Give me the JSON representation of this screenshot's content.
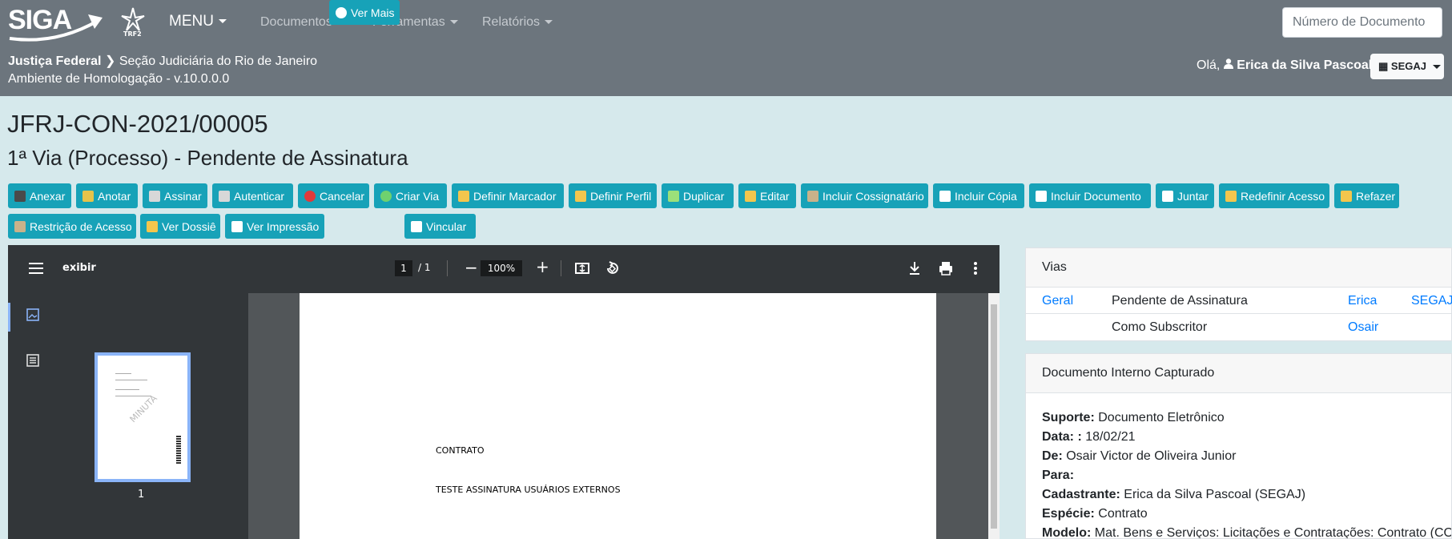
{
  "header": {
    "logo_text": "SIGA",
    "trf_label": "TRF2",
    "menu_label": "MENU",
    "nav": [
      "Documentos",
      "Ferramentas",
      "Relatórios"
    ],
    "search_placeholder": "Número de Documento",
    "breadcrumb_root": "Justiça Federal",
    "breadcrumb_child": "Seção Judiciária do Rio de Janeiro",
    "environment": "Ambiente de Homologação - v.10.0.0.0",
    "greeting": "Olá,",
    "user_name": "Erica da Silva Pascoal",
    "lotacao": "SEGAJ"
  },
  "document": {
    "code": "JFRJ-CON-2021/00005",
    "status": "1ª Via (Processo) - Pendente de Assinatura"
  },
  "actions": [
    {
      "label": "Anexar",
      "icon": "pen-icon",
      "color": "#4a4a4a"
    },
    {
      "label": "Anotar",
      "icon": "note-icon",
      "color": "#e6c34a"
    },
    {
      "label": "Assinar",
      "icon": "sign-icon",
      "color": "#d8d8d8"
    },
    {
      "label": "Autenticar",
      "icon": "authenticate-icon",
      "color": "#d8d8d8"
    },
    {
      "label": "Cancelar",
      "icon": "cancel-icon",
      "color": "#e03a3a"
    },
    {
      "label": "Criar Via",
      "icon": "add-icon",
      "color": "#6fd16f"
    },
    {
      "label": "Definir Marcador",
      "icon": "folder-icon",
      "color": "#f3c64d"
    },
    {
      "label": "Definir Perfil",
      "icon": "folder-user-icon",
      "color": "#f3c64d"
    },
    {
      "label": "Duplicar",
      "icon": "fork-icon",
      "color": "#9be07a"
    },
    {
      "label": "Editar",
      "icon": "pencil-icon",
      "color": "#f3c64d"
    },
    {
      "label": "Incluir Cossignatário",
      "icon": "user-add-icon",
      "color": "#c9b28a"
    },
    {
      "label": "Incluir Cópia",
      "icon": "copy-icon",
      "color": "#ffffff"
    },
    {
      "label": "Incluir Documento",
      "icon": "document-add-icon",
      "color": "#ffffff"
    },
    {
      "label": "Juntar",
      "icon": "attach-icon",
      "color": "#ffffff"
    },
    {
      "label": "Redefinir Acesso",
      "icon": "shield-icon",
      "color": "#f3c64d"
    },
    {
      "label": "Refazer",
      "icon": "warning-icon",
      "color": "#f3c64d"
    },
    {
      "label": "Restrição de Acesso",
      "icon": "user-lock-icon",
      "color": "#c9b28a"
    },
    {
      "label": "Ver Dossiê",
      "icon": "folder-open-icon",
      "color": "#f3c64d"
    },
    {
      "label": "Ver Impressão",
      "icon": "printer-icon",
      "color": "#ffffff"
    },
    {
      "label": "Ver Mais",
      "icon": "eye-icon",
      "color": "#ffffff"
    },
    {
      "label": "Vincular",
      "icon": "link-icon",
      "color": "#ffffff"
    }
  ],
  "pdf_viewer": {
    "title": "exibir",
    "current_page": "1",
    "page_separator": "/ 1",
    "zoom": "100%",
    "thumb_number": "1",
    "watermark": "MINUTA",
    "page_text_1": "CONTRATO",
    "page_text_2": "TESTE ASSINATURA USUÁRIOS EXTERNOS"
  },
  "vias_panel": {
    "title": "Vias",
    "rows": [
      {
        "col1": "Geral",
        "col2": "Pendente de Assinatura",
        "col3": "Erica",
        "col4": "SEGAJ"
      },
      {
        "col1": "",
        "col2": "Como Subscritor",
        "col3": "Osair",
        "col4": ""
      }
    ]
  },
  "doc_panel": {
    "title": "Documento Interno Capturado",
    "fields": [
      {
        "label": "Suporte:",
        "value": "Documento Eletrônico"
      },
      {
        "label": "Data: :",
        "value": "18/02/21"
      },
      {
        "label": "De:",
        "value": "Osair Victor de Oliveira Junior"
      },
      {
        "label": "Para:",
        "value": ""
      },
      {
        "label": "Cadastrante:",
        "value": "Erica da Silva Pascoal (SEGAJ)"
      },
      {
        "label": "Espécie:",
        "value": "Contrato"
      },
      {
        "label": "Modelo:",
        "value": "Mat. Bens e Serviços: Licitações e Contratações: Contrato (CON)"
      }
    ]
  },
  "colors": {
    "navbar": "#6c757d",
    "background": "#d6e9ec",
    "action_button": "#17a2b8",
    "link": "#007bff"
  }
}
